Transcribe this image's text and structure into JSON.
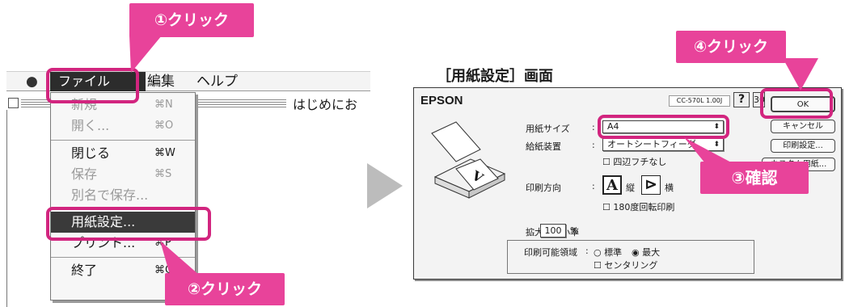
{
  "callouts": {
    "step1": "①クリック",
    "step2": "②クリック",
    "step3": "③確認",
    "step4": "④クリック"
  },
  "colors": {
    "accent": "#e8439a",
    "ring": "#d2257f"
  },
  "mac_menubar": {
    "apple_icon": "apple-icon",
    "file": "ファイル",
    "edit": "編集",
    "help": "ヘルプ"
  },
  "window": {
    "title": "はじめにお"
  },
  "file_menu": {
    "items": [
      {
        "label": "新規",
        "shortcut": "⌘N",
        "enabled": false
      },
      {
        "label": "開く...",
        "shortcut": "⌘O",
        "enabled": false
      },
      {
        "label": "閉じる",
        "shortcut": "⌘W",
        "enabled": true
      },
      {
        "label": "保存",
        "shortcut": "⌘S",
        "enabled": false
      },
      {
        "label": "別名で保存...",
        "shortcut": "",
        "enabled": false
      },
      {
        "label": "用紙設定...",
        "shortcut": "",
        "enabled": true,
        "highlighted": true
      },
      {
        "label": "プリント...",
        "shortcut": "⌘P",
        "enabled": true
      },
      {
        "label": "終了",
        "shortcut": "⌘Q",
        "enabled": true
      }
    ]
  },
  "dialog": {
    "heading": "［用紙設定］画面",
    "brand": "EPSON",
    "version": "CC-570L 1.00J",
    "help_label": "?",
    "num_label": "30",
    "buttons": {
      "ok": "OK",
      "cancel": "キャンセル",
      "print_settings": "印刷設定...",
      "custom_paper": "カスタム用紙..."
    },
    "paper_size": {
      "label": "用紙サイズ",
      "value": "A4"
    },
    "paper_source": {
      "label": "給紙装置",
      "value": "オートシートフィーダ"
    },
    "borderless": {
      "label": "四辺フチなし",
      "checked": false
    },
    "orientation": {
      "label": "印刷方向",
      "portrait": "縦",
      "landscape": "横",
      "selected": "portrait",
      "rotate180": "180度回転印刷"
    },
    "scale": {
      "label": "拡大／縮小率",
      "value": "100",
      "unit": "%"
    },
    "print_area": {
      "label": "印刷可能領域",
      "standard": "標準",
      "maximum": "最大",
      "selected": "maximum",
      "centering": "センタリング"
    }
  }
}
